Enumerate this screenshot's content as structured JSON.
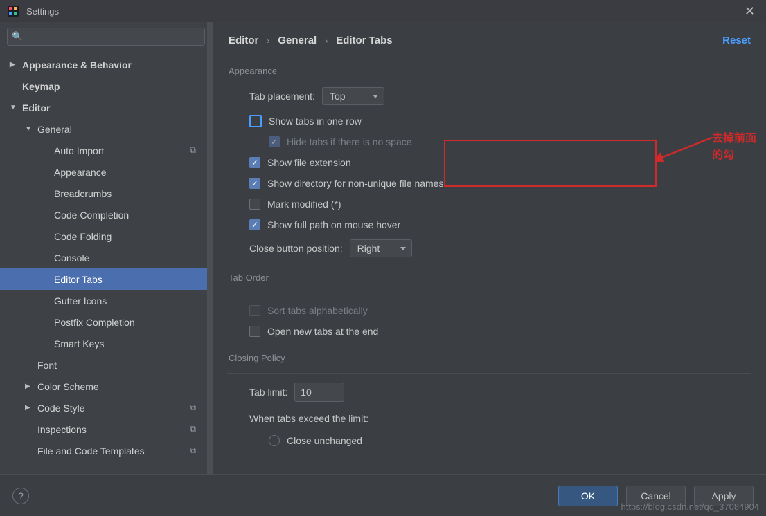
{
  "window": {
    "title": "Settings"
  },
  "search": {
    "placeholder": ""
  },
  "sidebar": {
    "items": [
      {
        "label": "Appearance & Behavior"
      },
      {
        "label": "Keymap"
      },
      {
        "label": "Editor"
      },
      {
        "label": "General"
      },
      {
        "label": "Auto Import"
      },
      {
        "label": "Appearance"
      },
      {
        "label": "Breadcrumbs"
      },
      {
        "label": "Code Completion"
      },
      {
        "label": "Code Folding"
      },
      {
        "label": "Console"
      },
      {
        "label": "Editor Tabs"
      },
      {
        "label": "Gutter Icons"
      },
      {
        "label": "Postfix Completion"
      },
      {
        "label": "Smart Keys"
      },
      {
        "label": "Font"
      },
      {
        "label": "Color Scheme"
      },
      {
        "label": "Code Style"
      },
      {
        "label": "Inspections"
      },
      {
        "label": "File and Code Templates"
      }
    ]
  },
  "breadcrumbs": {
    "a": "Editor",
    "b": "General",
    "c": "Editor Tabs"
  },
  "reset_label": "Reset",
  "sections": {
    "appearance": "Appearance",
    "tab_order": "Tab Order",
    "closing_policy": "Closing Policy"
  },
  "form": {
    "tab_placement_label": "Tab placement:",
    "tab_placement_value": "Top",
    "show_tabs_one_row": "Show tabs in one row",
    "hide_tabs_no_space": "Hide tabs if there is no space",
    "show_file_extension": "Show file extension",
    "show_dir_non_unique": "Show directory for non-unique file names",
    "mark_modified": "Mark modified (*)",
    "show_full_path": "Show full path on mouse hover",
    "close_btn_pos_label": "Close button position:",
    "close_btn_pos_value": "Right",
    "sort_tabs": "Sort tabs alphabetically",
    "open_new_tabs_end": "Open new tabs at the end",
    "tab_limit_label": "Tab limit:",
    "tab_limit_value": "10",
    "when_exceed": "When tabs exceed the limit:",
    "close_unchanged": "Close unchanged"
  },
  "annotation": {
    "text": "去掉前面的勾"
  },
  "footer": {
    "ok": "OK",
    "cancel": "Cancel",
    "apply": "Apply"
  },
  "watermark": "https://blog.csdn.net/qq_37084904"
}
